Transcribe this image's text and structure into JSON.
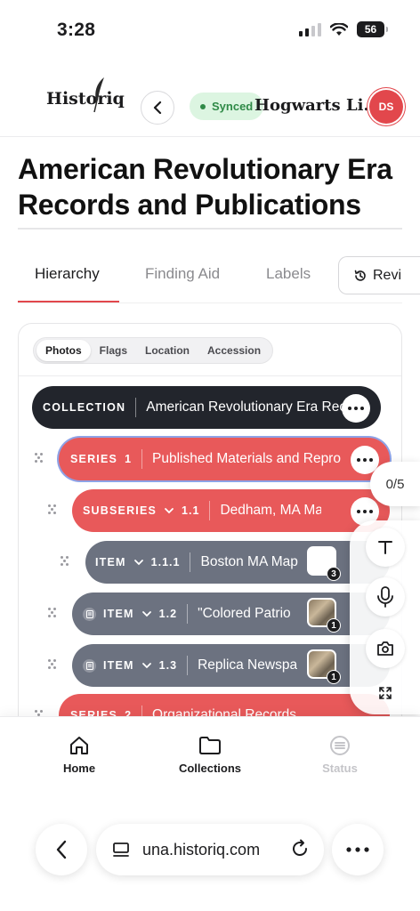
{
  "status_bar": {
    "time": "3:28",
    "battery": "56"
  },
  "header": {
    "logo_text": "Historiq",
    "back_icon": "chevron-left-icon",
    "sync_label": "Synced",
    "org_name": "Hogwarts Li...",
    "avatar_initials": "DS",
    "colors": {
      "brand_red": "#e2474c",
      "sync_green": "#2f8a47"
    }
  },
  "page": {
    "title": "American Revolutionary Era Records and Publications"
  },
  "tabs": [
    {
      "label": "Hierarchy",
      "active": true
    },
    {
      "label": "Finding Aid",
      "active": false
    },
    {
      "label": "Labels",
      "active": false
    }
  ],
  "review_button": {
    "label": "Revi",
    "icon": "history-icon"
  },
  "filters": [
    {
      "label": "Photos",
      "active": true
    },
    {
      "label": "Flags",
      "active": false
    },
    {
      "label": "Location",
      "active": false
    },
    {
      "label": "Accession",
      "active": false
    }
  ],
  "tree": [
    {
      "kind": "COLLECTION",
      "number": "",
      "name": "American Revolutionary Era Rec",
      "style": "dark"
    },
    {
      "kind": "SERIES",
      "number": "1",
      "name": "Published Materials and Repro",
      "style": "red",
      "selected": true
    },
    {
      "kind": "SUBSERIES",
      "number": "1.1",
      "name": "Dedham, MA Materi",
      "style": "red",
      "expandable": true
    },
    {
      "kind": "ITEM",
      "number": "1.1.1",
      "name": "Boston MA Map",
      "style": "gray",
      "expandable": true,
      "photo_count": "3"
    },
    {
      "kind": "ITEM",
      "number": "1.2",
      "name": "\"Colored Patrio",
      "style": "gray",
      "expandable": true,
      "photo_count": "1"
    },
    {
      "kind": "ITEM",
      "number": "1.3",
      "name": "Replica Newspa",
      "style": "gray",
      "expandable": true,
      "photo_count": "1"
    },
    {
      "kind": "SERIES",
      "number": "2",
      "name": "Organizational Records",
      "style": "red"
    }
  ],
  "progress": "0/5",
  "tools": [
    "text-icon",
    "microphone-icon",
    "camera-icon",
    "expand-icon"
  ],
  "bottom_nav": [
    {
      "label": "Home",
      "icon": "home-icon"
    },
    {
      "label": "Collections",
      "icon": "folder-icon"
    },
    {
      "label": "Status",
      "icon": "status-icon",
      "disabled": true
    }
  ],
  "browser": {
    "url": "una.historiq.com"
  }
}
